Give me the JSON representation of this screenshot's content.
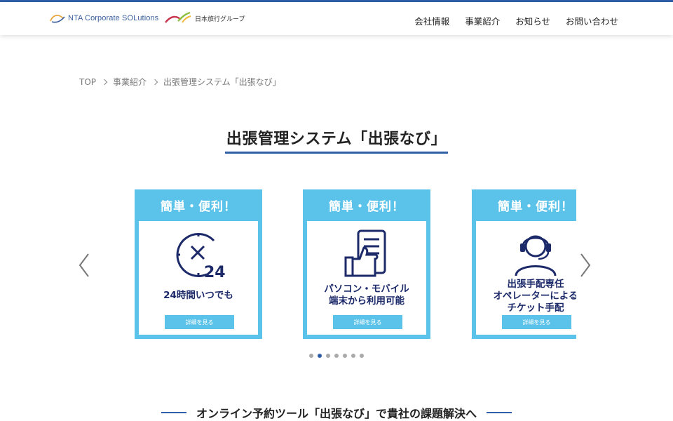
{
  "header": {
    "logo_text": "NTA Corporate SOLutions",
    "group_logo_text": "日本旅行グループ",
    "nav": [
      "会社情報",
      "事業紹介",
      "お知らせ",
      "お問い合わせ"
    ]
  },
  "breadcrumb": [
    "TOP",
    "事業紹介",
    "出張管理システム「出張なび」"
  ],
  "page_title": "出張管理システム「出張なび」",
  "carousel": {
    "cards": [
      {
        "heading": "簡単・便利！",
        "text": "24時間いつでも",
        "button": "詳細を見る",
        "icon": "clock-24-icon"
      },
      {
        "heading": "簡単・便利！",
        "text": "パソコン・モバイル\n端末から利用可能",
        "button": "詳細を見る",
        "icon": "thumbs-up-phone-icon"
      },
      {
        "heading": "簡単・便利！",
        "text": "出張手配専任\nオペレーターによる\nチケット手配",
        "button": "詳細を見る",
        "icon": "operator-headset-icon"
      }
    ],
    "dots_total": 7,
    "active_dot": 1
  },
  "section_title": "オンライン予約ツール「出張なび」で貴社の課題解決へ",
  "colors": {
    "accent": "#2f5fa8",
    "card": "#5bc3ea",
    "navy": "#1d2a6a"
  }
}
